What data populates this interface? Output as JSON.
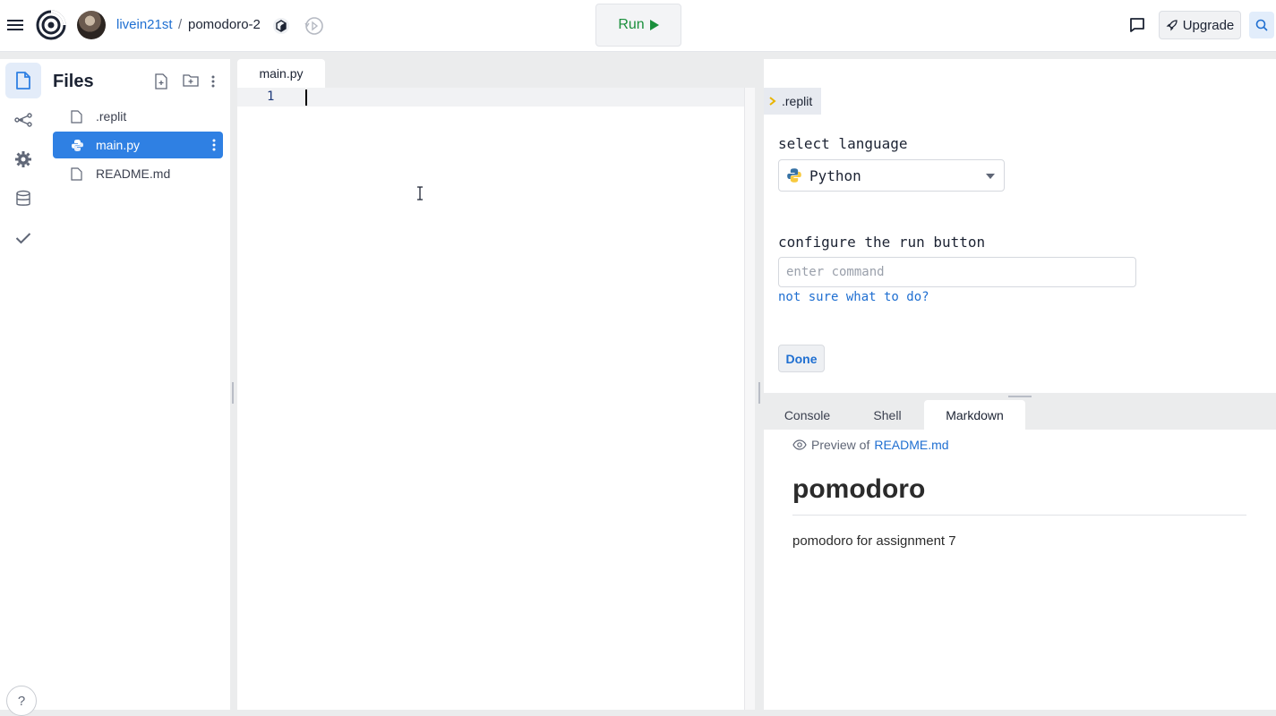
{
  "topbar": {
    "user": "livein21st",
    "separator": "/",
    "repl_name": "pomodoro-2",
    "run_label": "Run",
    "upgrade_label": "Upgrade"
  },
  "files_panel": {
    "title": "Files",
    "files": [
      {
        "name": ".replit",
        "icon": "file-icon"
      },
      {
        "name": "main.py",
        "icon": "python-icon",
        "active": true
      },
      {
        "name": "README.md",
        "icon": "file-icon"
      }
    ]
  },
  "editor": {
    "tab": "main.py",
    "line_number": "1"
  },
  "config": {
    "tab": ".replit",
    "language_label": "select language",
    "language_value": "Python",
    "run_label": "configure the run button",
    "command_placeholder": "enter command",
    "help_link": "not sure what to do?",
    "done_label": "Done"
  },
  "bottom": {
    "tabs": [
      "Console",
      "Shell",
      "Markdown"
    ],
    "active_tab": "Markdown",
    "preview_prefix": "Preview of",
    "preview_file": "README.md",
    "markdown_heading": "pomodoro",
    "markdown_text": "pomodoro for assignment 7"
  },
  "colors": {
    "accent": "#2f80e3",
    "run_green": "#1a8f3c",
    "link_blue": "#1f6fd1"
  }
}
